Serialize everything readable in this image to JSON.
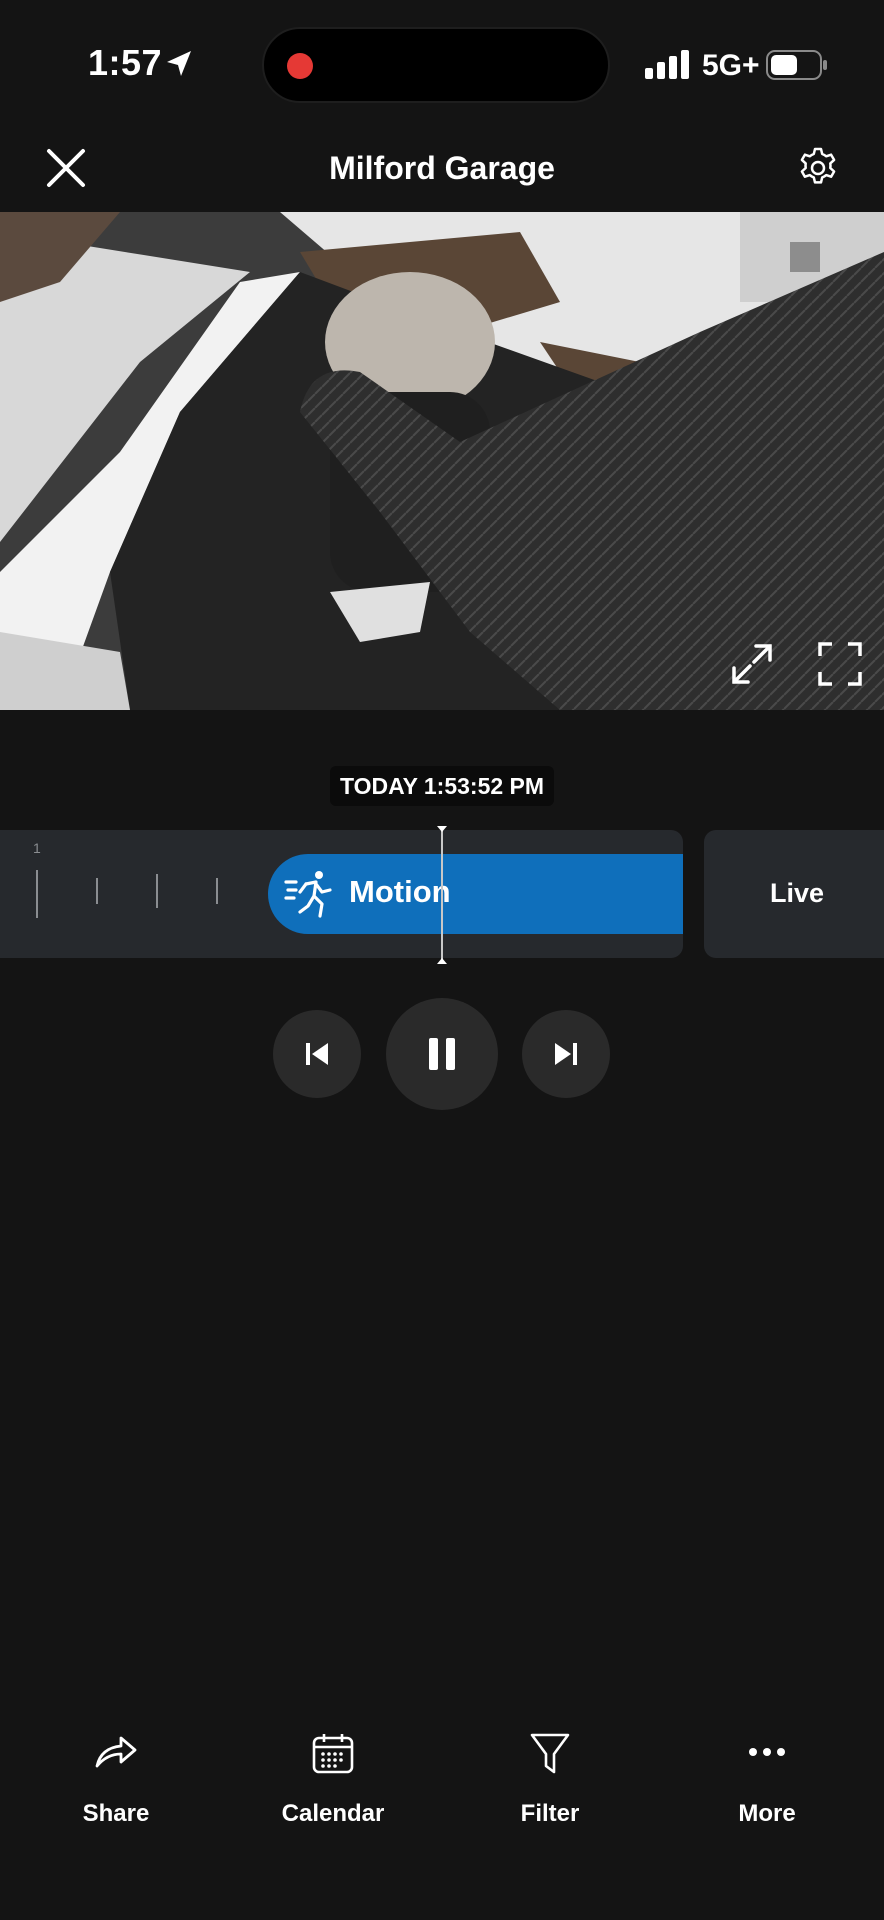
{
  "status_bar": {
    "time": "1:57",
    "network": "5G+",
    "recording_indicator_color": "#e53935"
  },
  "header": {
    "title": "Milford Garage",
    "close_icon": "close-icon",
    "settings_icon": "gear-icon"
  },
  "video": {
    "expand_icon": "expand-arrows-icon",
    "fullscreen_icon": "fullscreen-icon"
  },
  "timeline": {
    "timestamp": "TODAY 1:53:52 PM",
    "tick_label": "1",
    "event": {
      "label": "Motion",
      "icon": "running-person-icon",
      "color": "#0f6fbb"
    },
    "live_label": "Live"
  },
  "playback": {
    "previous_icon": "skip-previous-icon",
    "pause_icon": "pause-icon",
    "next_icon": "skip-next-icon"
  },
  "bottom_bar": {
    "items": [
      {
        "label": "Share",
        "icon": "share-icon"
      },
      {
        "label": "Calendar",
        "icon": "calendar-icon"
      },
      {
        "label": "Filter",
        "icon": "filter-icon"
      },
      {
        "label": "More",
        "icon": "more-dots-icon"
      }
    ]
  }
}
